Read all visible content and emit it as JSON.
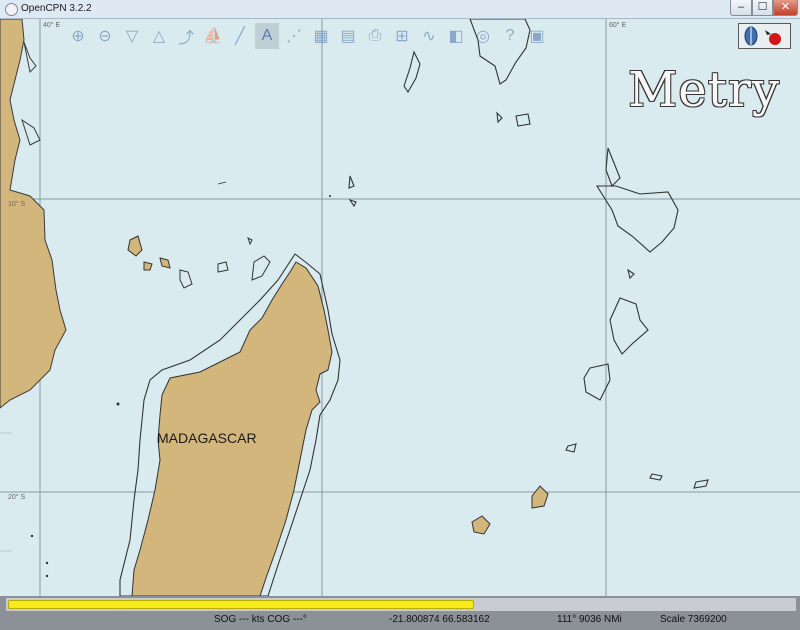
{
  "window": {
    "title": "OpenCPN 3.2.2",
    "minimize_icon": "minimize-icon",
    "maximize_icon": "maximize-icon",
    "close_icon": "close-icon"
  },
  "toolbar": {
    "tools": [
      {
        "name": "zoom-in-icon",
        "glyph": "⊕"
      },
      {
        "name": "zoom-out-icon",
        "glyph": "⊖"
      },
      {
        "name": "scale-in-icon",
        "glyph": "▽"
      },
      {
        "name": "scale-out-icon",
        "glyph": "△"
      },
      {
        "name": "route-icon",
        "glyph": "⤴"
      },
      {
        "name": "boat-follow-icon",
        "glyph": "⛵"
      },
      {
        "name": "measure-icon",
        "glyph": "╱"
      },
      {
        "name": "text-icon",
        "glyph": "A"
      },
      {
        "name": "current-icon",
        "glyph": "⋰"
      },
      {
        "name": "tide-icon",
        "glyph": "▦"
      },
      {
        "name": "chart-quilt-icon",
        "glyph": "▤"
      },
      {
        "name": "print-icon",
        "glyph": "⎙"
      },
      {
        "name": "route-manager-icon",
        "glyph": "⊞"
      },
      {
        "name": "track-icon",
        "glyph": "∿"
      },
      {
        "name": "color-scheme-icon",
        "glyph": "◧"
      },
      {
        "name": "mob-icon",
        "glyph": "◎"
      },
      {
        "name": "help-icon",
        "glyph": "?"
      },
      {
        "name": "settings-icon",
        "glyph": "▣"
      }
    ]
  },
  "logo": "Metry",
  "map": {
    "label_madagascar": "MADAGASCAR",
    "grid_labels": {
      "lon40": "40° E",
      "lon60": "60° E",
      "lat10": "10° S",
      "lat20": "20° S"
    }
  },
  "status": {
    "progress_fraction": 0.59,
    "sog_cog": "SOG --- kts  COG ---°",
    "position": "-21.800874   66.583162",
    "bearing_distance": "111°  9036 NMi",
    "scale": "Scale 7369200"
  }
}
